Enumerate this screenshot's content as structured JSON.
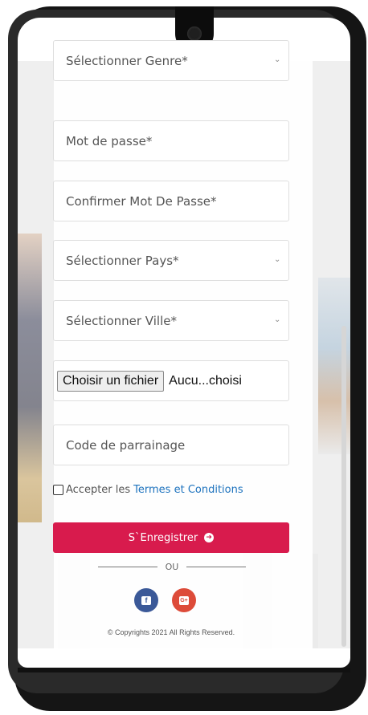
{
  "form": {
    "gender_select": {
      "label": "Sélectionner Genre*"
    },
    "password": {
      "placeholder": "Mot de passe*"
    },
    "confirm_password": {
      "placeholder": "Confirmer Mot De Passe*"
    },
    "country_select": {
      "label": "Sélectionner Pays*"
    },
    "city_select": {
      "label": "Sélectionner Ville*"
    },
    "file_input": {
      "button_label": "Choisir un fichier",
      "status": "Aucu...choisi"
    },
    "referral_code": {
      "placeholder": "Code de parrainage"
    },
    "terms": {
      "prefix": "Accepter les",
      "link": "Termes et Conditions",
      "checked": false
    },
    "register_button": {
      "label": "S`Enregistrer"
    },
    "or_divider": "OU",
    "social": [
      {
        "name": "facebook",
        "glyph": "f",
        "color": "#3b5998"
      },
      {
        "name": "google-plus",
        "glyph": "G+",
        "color": "#dd4b39"
      }
    ],
    "copyright": "© Copyrights 2021 All Rights Reserved."
  },
  "icons": {
    "select_chevron": "chevron-down-icon",
    "register_arrow": "arrow-right-circle-icon"
  },
  "colors": {
    "accent": "#d81b4d",
    "link": "#1e73be",
    "facebook": "#3b5998",
    "google": "#dd4b39"
  }
}
